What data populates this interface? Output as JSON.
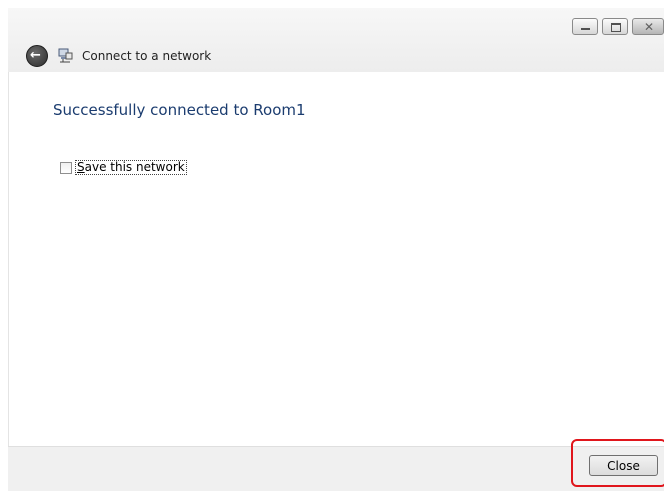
{
  "window": {
    "title": "Connect to a network",
    "caption_buttons": {
      "minimize": "minimize-icon",
      "maximize": "maximize-icon",
      "close": "close-icon"
    }
  },
  "main": {
    "status": "Successfully connected to Room1",
    "save_network": {
      "label_prefix": "S",
      "label_rest": "ave this network",
      "checked": false
    }
  },
  "footer": {
    "close_label": "Close"
  },
  "colors": {
    "status_text": "#1b3c6f",
    "highlight": "#e0161c"
  }
}
